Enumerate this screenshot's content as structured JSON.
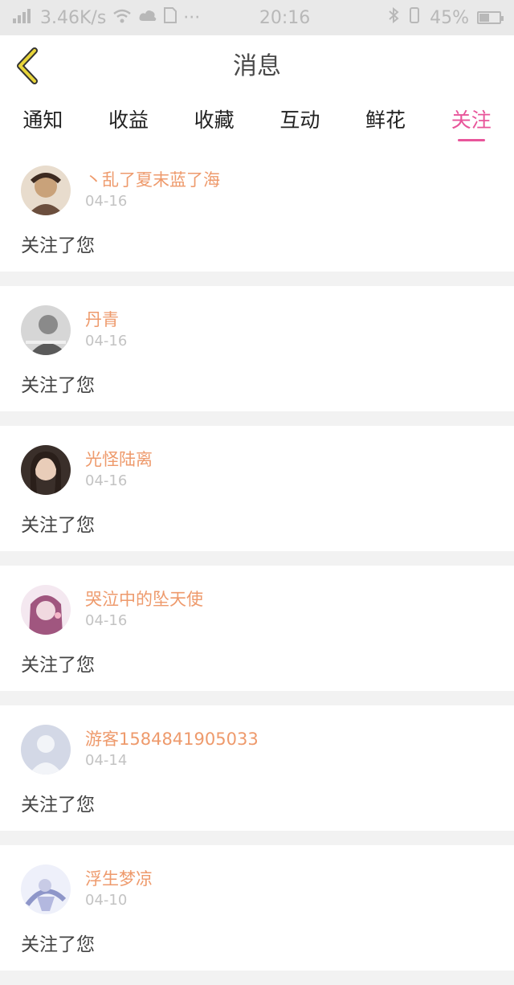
{
  "status_bar": {
    "network_speed": "3.46K/s",
    "time": "20:16",
    "battery": "45%",
    "icons": [
      "signal-icon",
      "wifi-icon",
      "cloud-icon",
      "sim-icon",
      "more-dots-icon",
      "bluetooth-icon",
      "vibrate-icon",
      "battery-icon"
    ]
  },
  "header": {
    "title": "消息",
    "back_icon": "chevron-left-icon"
  },
  "tabs": [
    {
      "label": "通知",
      "active": false
    },
    {
      "label": "收益",
      "active": false
    },
    {
      "label": "收藏",
      "active": false
    },
    {
      "label": "互动",
      "active": false
    },
    {
      "label": "鲜花",
      "active": false
    },
    {
      "label": "关注",
      "active": true
    }
  ],
  "notifications": [
    {
      "username": "丶乱了夏末蓝了海",
      "date": "04-16",
      "message": "关注了您",
      "avatar_color": "#c9a27a"
    },
    {
      "username": "丹青",
      "date": "04-16",
      "message": "关注了您",
      "avatar_color": "#9a9a9a"
    },
    {
      "username": "光怪陆离",
      "date": "04-16",
      "message": "关注了您",
      "avatar_color": "#5a4a40"
    },
    {
      "username": "哭泣中的坠天使",
      "date": "04-16",
      "message": "关注了您",
      "avatar_color": "#a0567f"
    },
    {
      "username": "游客1584841905033",
      "date": "04-14",
      "message": "关注了您",
      "avatar_color": "#d3d8e6"
    },
    {
      "username": "浮生梦凉",
      "date": "04-10",
      "message": "关注了您",
      "avatar_color": "#c8cbe6"
    }
  ],
  "colors": {
    "accent": "#e8559a",
    "username": "#ee9a6c",
    "back_icon": "#e8d53a"
  }
}
